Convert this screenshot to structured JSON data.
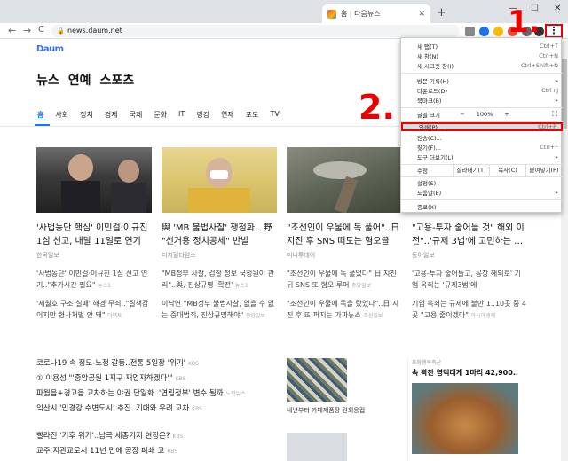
{
  "browser": {
    "tab_title": "홈 | 다음뉴스",
    "tab_close": "✕",
    "new_tab": "+",
    "min": "—",
    "max": "☐",
    "close": "✕",
    "url": "news.daum.net",
    "back": "←",
    "forward": "→",
    "reload": "C",
    "menu_dots": "⋮"
  },
  "page": {
    "logo": "Daum",
    "sections": [
      "뉴스",
      "연예",
      "스포츠"
    ],
    "categories": [
      "홈",
      "사회",
      "정치",
      "경제",
      "국제",
      "문화",
      "IT",
      "랭킹",
      "연재",
      "포토",
      "TV"
    ],
    "cards": [
      {
        "headline": "'사법농단 핵심' 이민걸·이규진 1심 선고, 내달 11일로 연기",
        "source": "한국일보",
        "sub1": "'사법농단' 이민걸·이규진 1심 선고 연기..\"추가시간 필요\"",
        "sub1_src": "뉴스1",
        "sub2": "'세월호 구조 실패' 해경 무죄..\"질책감이지만 형사처벌 안 돼\"",
        "sub2_src": "더팩트"
      },
      {
        "headline": "與 'MB 불법사찰' 쟁점화.. 野 \"선거용 정치공세\" 반발",
        "source": "디지털타임스",
        "sub1": "\"MB정부 사찰, 검찰 정보 국정원이 관리\"..與, 진상규명 '확전'",
        "sub1_src": "뉴스1",
        "sub2": "이낙연 \"MB정부 불법사찰, 없을 수 없는 중대범죄, 진상규명해야\"",
        "sub2_src": "중앙일보"
      },
      {
        "headline": "\"조선인이 우물에 독 풀어\"..日 지진 후 SNS 떠도는 혐오글",
        "source": "머니투데이",
        "sub1": "\"조선인이 우물에 독 풀었다\" 日 지진 뒤 SNS 또 혐오 루머",
        "sub1_src": "중앙일보",
        "sub2": "\"조선인이 우물에 독을 탔었다\"..日 지진 후 또 퍼지는 가짜뉴스",
        "sub2_src": "조선일보"
      },
      {
        "headline": "\"고용-투자 줄어들 것\" 해외 이전\"..'규제 3법'에 고민하는 …",
        "source": "동아일보",
        "sub1": "'고용-투자 줄어들고, 공장 해외로' 기업 옥죄는 '규제3법'에",
        "sub1_src": "",
        "sub2": "기업 옥죄는 규제에 불만 1..10곳 중 4곳 \"고용 줄이겠다\"",
        "sub2_src": "아시아경제"
      }
    ],
    "list": [
      {
        "text": "코로나19 속 정모-노정 갈등..전통 5일장 '위기'",
        "src": "KBS"
      },
      {
        "text": "① 이용성 \"'중앙공원 1지구 재업자하겠다'\"",
        "src": "KBS"
      },
      {
        "text": "파월음+경고음 교차하는 야권 단일화..'연립정부' 변수 될까",
        "src": "노컷뉴스"
      },
      {
        "text": "익산시 '민경강 수변도시' 추진..기대와 우려 교차",
        "src": "KBS"
      },
      {
        "text": "빨라진 '기후 위기'..남극 세종기지 현장은?",
        "src": "KBS"
      },
      {
        "text": "교주 지관교로서 11년 만에 공장 폐쇄 고",
        "src": "KBS"
      }
    ],
    "photo_caption": "내년부터 카페제품장 원회용컵",
    "ad_source": "포항행복축산",
    "ad_title": "속 꽉찬 영덕대게 1마리 42,900.."
  },
  "menu": {
    "items": [
      {
        "label": "새 탭(T)",
        "shortcut": "Ctrl+T"
      },
      {
        "label": "새 창(N)",
        "shortcut": "Ctrl+N"
      },
      {
        "label": "새 시크릿 창(I)",
        "shortcut": "Ctrl+Shift+N"
      },
      {
        "label": "방문 기록(H)",
        "shortcut": "▸"
      },
      {
        "label": "다운로드(D)",
        "shortcut": "Ctrl+J"
      },
      {
        "label": "북마크(B)",
        "shortcut": "▸"
      },
      {
        "label": "인쇄(P)...",
        "shortcut": "Ctrl+P"
      },
      {
        "label": "전송(C)...",
        "shortcut": ""
      },
      {
        "label": "찾기(F)...",
        "shortcut": "Ctrl+F"
      },
      {
        "label": "도구 더보기(L)",
        "shortcut": "▸"
      },
      {
        "label": "설정(S)",
        "shortcut": ""
      },
      {
        "label": "도움말(E)",
        "shortcut": "▸"
      },
      {
        "label": "종료(X)",
        "shortcut": ""
      }
    ],
    "zoom_label": "글꼴 크기",
    "zoom_minus": "−",
    "zoom_value": "100%",
    "zoom_plus": "+",
    "fullscreen": "⛶",
    "edit_label": "수정",
    "edit_cut": "잘라내기(T)",
    "edit_copy": "복사(C)",
    "edit_paste": "붙여넣기(P)"
  },
  "annotations": {
    "step1": "1.",
    "step2": "2."
  }
}
